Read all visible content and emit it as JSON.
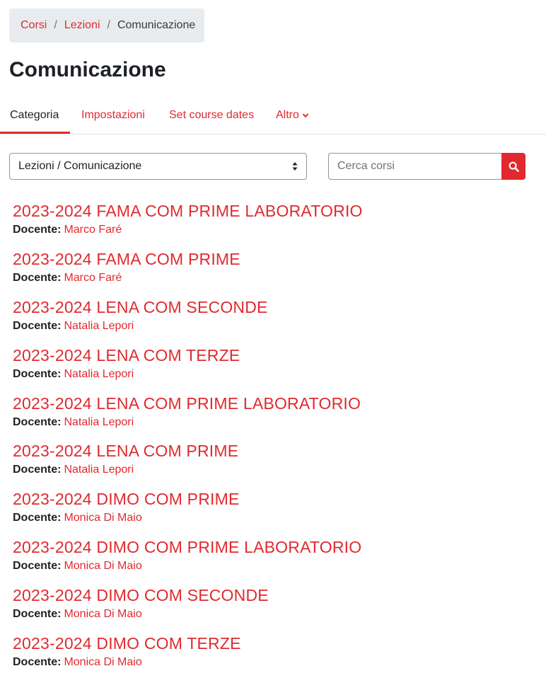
{
  "breadcrumb": {
    "items": [
      "Corsi",
      "Lezioni"
    ],
    "current": "Comunicazione",
    "separator": "/"
  },
  "page": {
    "title": "Comunicazione"
  },
  "secondary_nav": {
    "tabs": [
      {
        "label": "Categoria",
        "active": true
      },
      {
        "label": "Impostazioni",
        "active": false
      },
      {
        "label": "Set course dates",
        "active": false
      },
      {
        "label": "Altro",
        "active": false,
        "icon": "chevron-down-icon"
      }
    ]
  },
  "filters": {
    "category_select_value": "Lezioni / Comunicazione",
    "search_placeholder": "Cerca corsi",
    "search_icon": "search-icon"
  },
  "courses": {
    "teacher_label": "Docente:",
    "items": [
      {
        "name": "2023-2024 FAMA COM PRIME LABORATORIO",
        "teacher": "Marco Faré"
      },
      {
        "name": "2023-2024 FAMA COM PRIME",
        "teacher": "Marco Faré"
      },
      {
        "name": "2023-2024 LENA COM SECONDE",
        "teacher": "Natalia Lepori"
      },
      {
        "name": "2023-2024 LENA COM TERZE",
        "teacher": "Natalia Lepori"
      },
      {
        "name": "2023-2024 LENA COM PRIME LABORATORIO",
        "teacher": "Natalia Lepori"
      },
      {
        "name": "2023-2024 LENA COM PRIME",
        "teacher": "Natalia Lepori"
      },
      {
        "name": "2023-2024 DIMO COM PRIME",
        "teacher": "Monica Di Maio"
      },
      {
        "name": "2023-2024 DIMO COM PRIME LABORATORIO",
        "teacher": "Monica Di Maio"
      },
      {
        "name": "2023-2024 DIMO COM SECONDE",
        "teacher": "Monica Di Maio"
      },
      {
        "name": "2023-2024 DIMO COM TERZE",
        "teacher": "Monica Di Maio"
      }
    ]
  },
  "colors": {
    "accent": "#e02a2f",
    "text": "#1d2125",
    "breadcrumb_bg": "#e9ecef"
  }
}
